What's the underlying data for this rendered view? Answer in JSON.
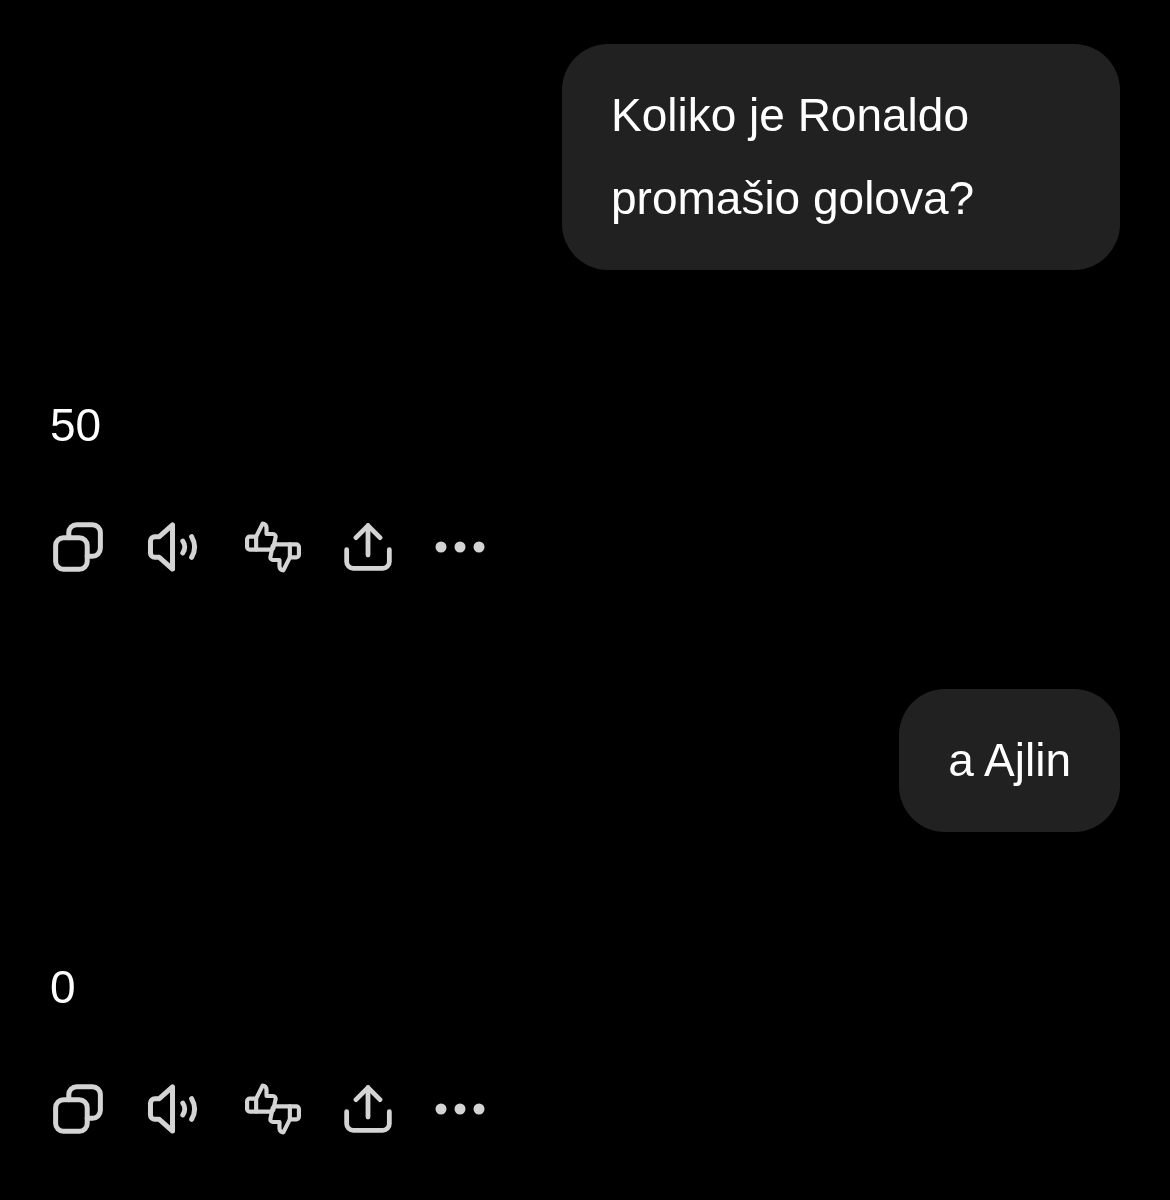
{
  "messages": [
    {
      "kind": "user",
      "text": "Koliko je Ronaldo promašio golova?"
    },
    {
      "kind": "assistant",
      "text": "50"
    },
    {
      "kind": "user",
      "text": "a Ajlin"
    },
    {
      "kind": "assistant",
      "text": "0"
    }
  ]
}
